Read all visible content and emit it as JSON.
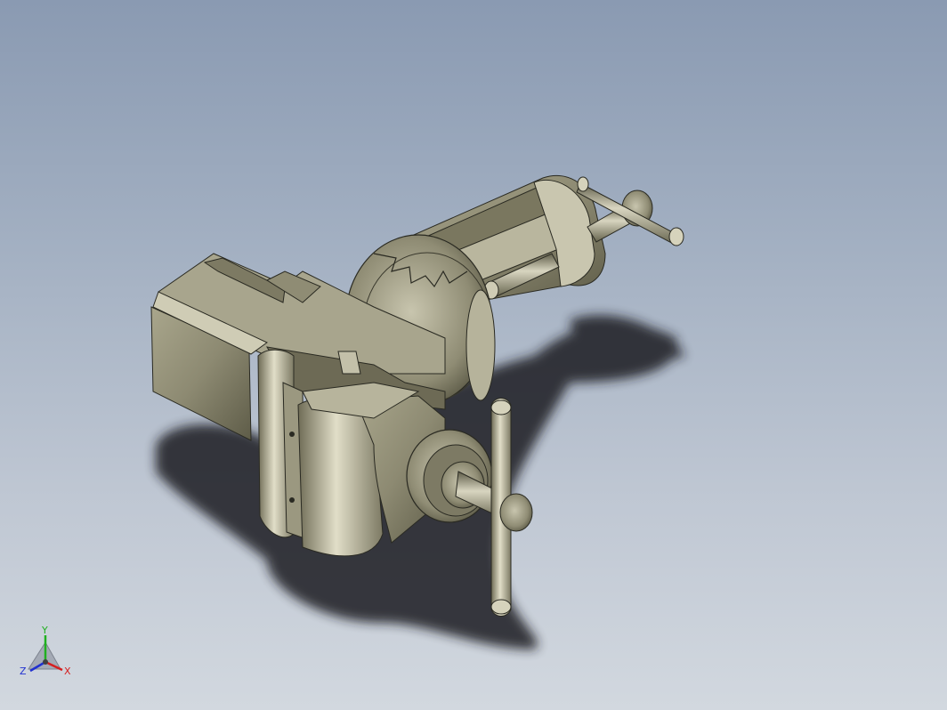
{
  "triad": {
    "x_label": "X",
    "y_label": "Y",
    "z_label": "Z",
    "x_color": "#d42020",
    "y_color": "#20b020",
    "z_color": "#2030d0"
  },
  "colors": {
    "background_top": "#8a9ab2",
    "background_bottom": "#d2d8df",
    "model_body": "#8d8a72",
    "model_highlight": "#d7d4bd",
    "model_shadow": "#55533f",
    "ground_shadow": "#1c1c22"
  },
  "model": {
    "icon": "bench-vise-3d-model"
  }
}
